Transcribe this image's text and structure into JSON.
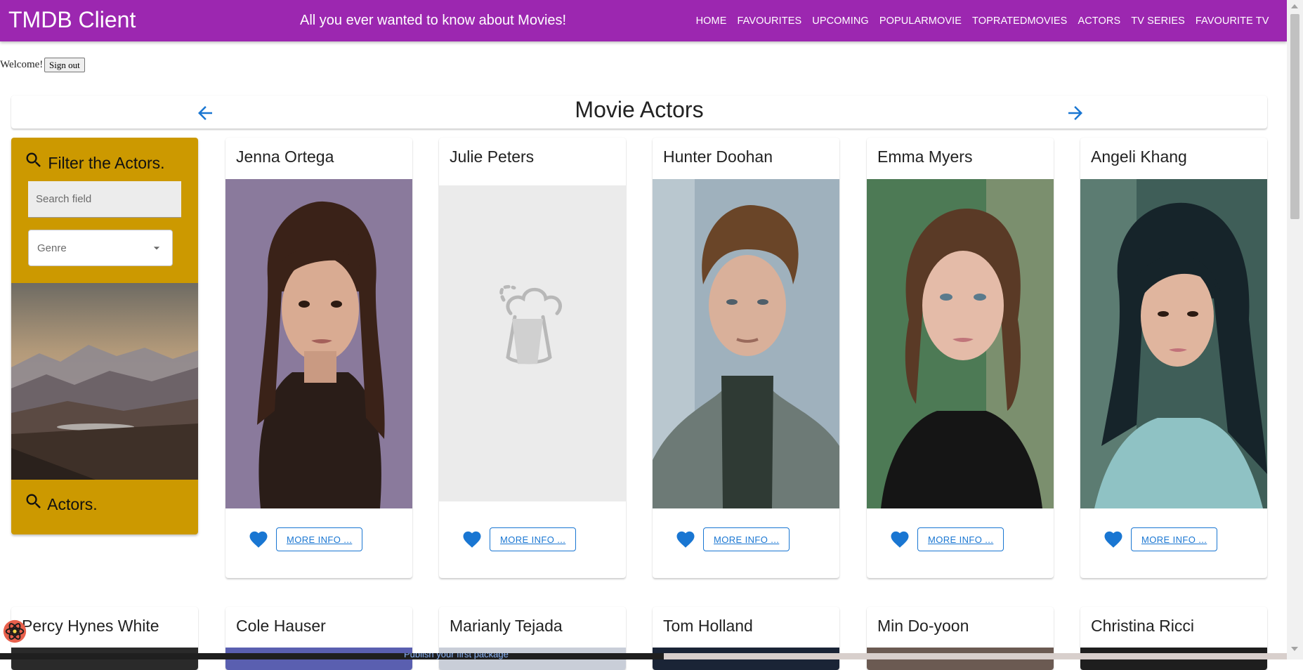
{
  "appbar": {
    "title": "TMDB Client",
    "tagline": "All you ever wanted to know about Movies!",
    "nav": [
      "HOME",
      "FAVOURITES",
      "UPCOMING",
      "POPULARMOVIE",
      "TOPRATEDMOVIES",
      "ACTORS",
      "TV SERIES",
      "FAVOURITE TV"
    ]
  },
  "welcome": {
    "text": "Welcome!",
    "signout": "Sign out"
  },
  "header": {
    "title": "Movie Actors"
  },
  "filter": {
    "heading": "Filter the Actors.",
    "search_placeholder": "Search field",
    "genre_label": "Genre",
    "footer": "Actors."
  },
  "actors_row1": [
    {
      "name": "Jenna Ortega",
      "more": "MORE INFO ..."
    },
    {
      "name": "Julie Peters",
      "more": "MORE INFO ..."
    },
    {
      "name": "Hunter Doohan",
      "more": "MORE INFO ..."
    },
    {
      "name": "Emma Myers",
      "more": "MORE INFO ..."
    },
    {
      "name": "Angeli Khang",
      "more": "MORE INFO ..."
    }
  ],
  "actors_row2": [
    {
      "name": "Percy Hynes White"
    },
    {
      "name": "Cole Hauser"
    },
    {
      "name": "Marianly Tejada"
    },
    {
      "name": "Tom Holland"
    },
    {
      "name": "Min Do-yoon"
    },
    {
      "name": "Christina Ricci"
    }
  ],
  "taskbar": {
    "text": "Publish your first package"
  },
  "colors": {
    "appbar": "#9c27b0",
    "filter_card": "#cc9900",
    "accent": "#1976d2"
  }
}
